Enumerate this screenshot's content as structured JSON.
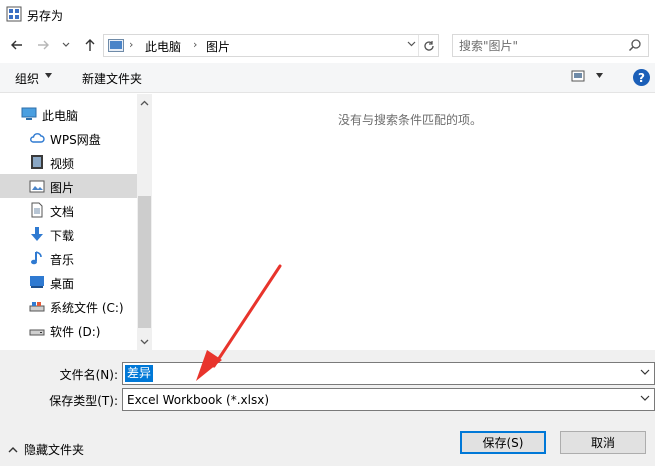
{
  "window": {
    "title": "另存为"
  },
  "address": {
    "path": [
      "此电脑",
      "图片"
    ]
  },
  "search": {
    "placeholder": "搜索\"图片\""
  },
  "toolbar": {
    "organize": "组织",
    "new_folder": "新建文件夹"
  },
  "navigation": {
    "items": [
      {
        "label": "此电脑",
        "icon": "computer-icon"
      },
      {
        "label": "WPS网盘",
        "icon": "cloud-icon"
      },
      {
        "label": "视频",
        "icon": "video-icon"
      },
      {
        "label": "图片",
        "icon": "picture-icon",
        "selected": true
      },
      {
        "label": "文档",
        "icon": "document-icon"
      },
      {
        "label": "下载",
        "icon": "download-icon"
      },
      {
        "label": "音乐",
        "icon": "music-icon"
      },
      {
        "label": "桌面",
        "icon": "desktop-icon"
      },
      {
        "label": "系统文件 (C:)",
        "icon": "drive-icon"
      },
      {
        "label": "软件 (D:)",
        "icon": "drive-icon"
      }
    ]
  },
  "content": {
    "empty_message": "没有与搜索条件匹配的项。"
  },
  "form": {
    "filename_label": "文件名(N):",
    "filename_value": "差异",
    "filetype_label": "保存类型(T):",
    "filetype_value": "Excel Workbook (*.xlsx)"
  },
  "footer": {
    "hide_folders": "隐藏文件夹",
    "save": "保存(S)",
    "cancel": "取消"
  },
  "colors": {
    "accent": "#0078d7",
    "annotation": "#e8342c"
  }
}
